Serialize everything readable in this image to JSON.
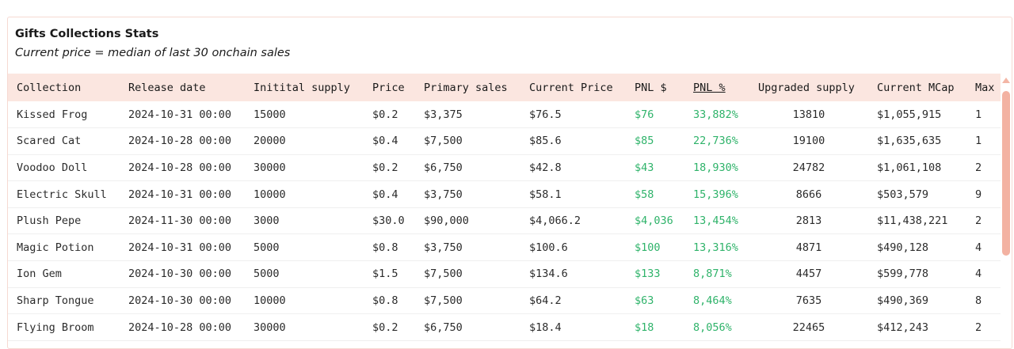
{
  "card": {
    "title": "Gifts Collections Stats",
    "subtitle": "Current price = median of last 30 onchain sales"
  },
  "table": {
    "columns": [
      {
        "label": "Collection"
      },
      {
        "label": "Release date"
      },
      {
        "label": "Initital supply"
      },
      {
        "label": "Price"
      },
      {
        "label": "Primary sales"
      },
      {
        "label": "Current Price"
      },
      {
        "label": "PNL $"
      },
      {
        "label": "PNL %",
        "sorted": true
      },
      {
        "label": "Upgraded supply"
      },
      {
        "label": "Current MCap"
      },
      {
        "label": "Max"
      }
    ],
    "rows": [
      [
        "Kissed Frog",
        "2024-10-31 00:00",
        "15000",
        "$0.2",
        "$3,375",
        "$76.5",
        "$76",
        "33,882%",
        "13810",
        "$1,055,915",
        "1"
      ],
      [
        "Scared Cat",
        "2024-10-28 00:00",
        "20000",
        "$0.4",
        "$7,500",
        "$85.6",
        "$85",
        "22,736%",
        "19100",
        "$1,635,635",
        "1"
      ],
      [
        "Voodoo Doll",
        "2024-10-28 00:00",
        "30000",
        "$0.2",
        "$6,750",
        "$42.8",
        "$43",
        "18,930%",
        "24782",
        "$1,061,108",
        "2"
      ],
      [
        "Electric Skull",
        "2024-10-31 00:00",
        "10000",
        "$0.4",
        "$3,750",
        "$58.1",
        "$58",
        "15,396%",
        "8666",
        "$503,579",
        "9"
      ],
      [
        "Plush Pepe",
        "2024-11-30 00:00",
        "3000",
        "$30.0",
        "$90,000",
        "$4,066.2",
        "$4,036",
        "13,454%",
        "2813",
        "$11,438,221",
        "2"
      ],
      [
        "Magic Potion",
        "2024-10-31 00:00",
        "5000",
        "$0.8",
        "$3,750",
        "$100.6",
        "$100",
        "13,316%",
        "4871",
        "$490,128",
        "4"
      ],
      [
        "Ion Gem",
        "2024-10-30 00:00",
        "5000",
        "$1.5",
        "$7,500",
        "$134.6",
        "$133",
        "8,871%",
        "4457",
        "$599,778",
        "4"
      ],
      [
        "Sharp Tongue",
        "2024-10-30 00:00",
        "10000",
        "$0.8",
        "$7,500",
        "$64.2",
        "$63",
        "8,464%",
        "7635",
        "$490,369",
        "8"
      ],
      [
        "Flying Broom",
        "2024-10-28 00:00",
        "30000",
        "$0.2",
        "$6,750",
        "$18.4",
        "$18",
        "8,056%",
        "22465",
        "$412,243",
        "2"
      ]
    ]
  },
  "colors": {
    "header_bg": "#fbe6e0",
    "positive": "#2fb36a",
    "scrollbar": "#f3b2a2"
  }
}
